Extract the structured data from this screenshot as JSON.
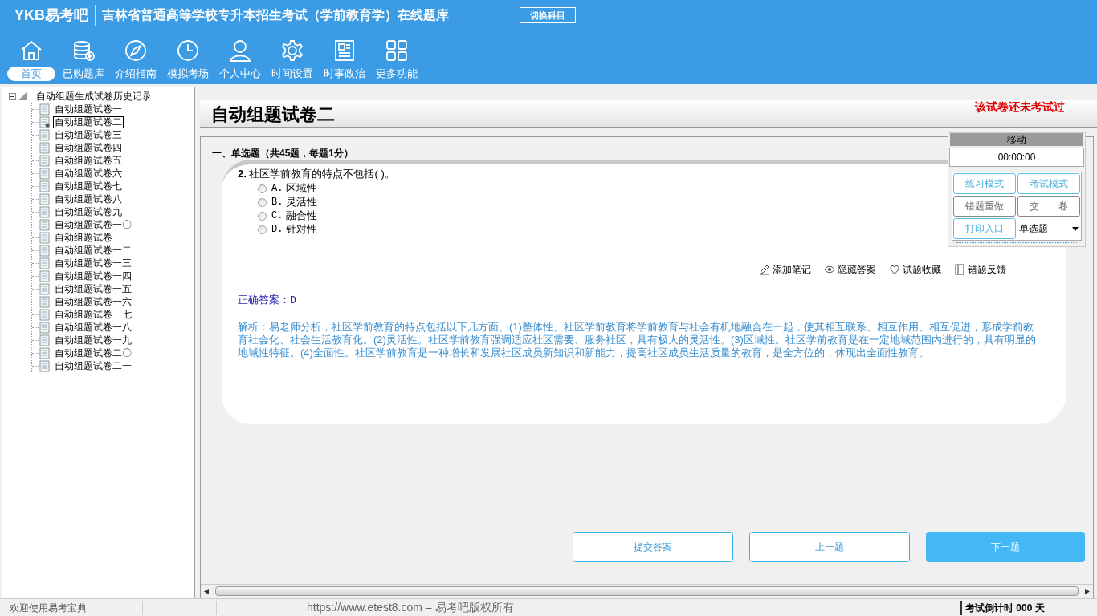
{
  "header": {
    "logo": "YKB易考吧",
    "title": "吉林省普通高等学校专升本招生考试（学前教育学）在线题库",
    "switch_button": "切换科目"
  },
  "nav": [
    {
      "label": "首页",
      "kind": "home",
      "selected": true
    },
    {
      "label": "已购题库",
      "kind": "database",
      "selected": false
    },
    {
      "label": "介绍指南",
      "kind": "compass",
      "selected": false
    },
    {
      "label": "模拟考场",
      "kind": "clock",
      "selected": false
    },
    {
      "label": "个人中心",
      "kind": "user",
      "selected": false
    },
    {
      "label": "时间设置",
      "kind": "gear",
      "selected": false
    },
    {
      "label": "时事政治",
      "kind": "news",
      "selected": false
    },
    {
      "label": "更多功能",
      "kind": "grid",
      "selected": false
    }
  ],
  "tree": {
    "root": "自动组题生成试卷历史记录",
    "expanded": true,
    "children": [
      {
        "label": "自动组题试卷一",
        "selected": false
      },
      {
        "label": "自动组题试卷二",
        "selected": true
      },
      {
        "label": "自动组题试卷三",
        "selected": false
      },
      {
        "label": "自动组题试卷四",
        "selected": false
      },
      {
        "label": "自动组题试卷五",
        "selected": false
      },
      {
        "label": "自动组题试卷六",
        "selected": false
      },
      {
        "label": "自动组题试卷七",
        "selected": false
      },
      {
        "label": "自动组题试卷八",
        "selected": false
      },
      {
        "label": "自动组题试卷九",
        "selected": false
      },
      {
        "label": "自动组题试卷一〇",
        "selected": false
      },
      {
        "label": "自动组题试卷一一",
        "selected": false
      },
      {
        "label": "自动组题试卷一二",
        "selected": false
      },
      {
        "label": "自动组题试卷一三",
        "selected": false
      },
      {
        "label": "自动组题试卷一四",
        "selected": false
      },
      {
        "label": "自动组题试卷一五",
        "selected": false
      },
      {
        "label": "自动组题试卷一六",
        "selected": false
      },
      {
        "label": "自动组题试卷一七",
        "selected": false
      },
      {
        "label": "自动组题试卷一八",
        "selected": false
      },
      {
        "label": "自动组题试卷一九",
        "selected": false
      },
      {
        "label": "自动组题试卷二〇",
        "selected": false
      },
      {
        "label": "自动组题试卷二一",
        "selected": false
      }
    ]
  },
  "paper": {
    "title": "自动组题试卷二",
    "status": "该试卷还未考试过"
  },
  "section": "一、单选题（共45题，每题1分）",
  "question": {
    "number": "2.",
    "text": "社区学前教育的特点不包括( )。",
    "options": [
      {
        "label": "A.",
        "text": "区域性",
        "selected": false
      },
      {
        "label": "B.",
        "text": "灵活性",
        "selected": false
      },
      {
        "label": "C.",
        "text": "融合性",
        "selected": false
      },
      {
        "label": "D.",
        "text": "针对性",
        "selected": false
      }
    ]
  },
  "actions": [
    {
      "label": "添加笔记",
      "kind": "pencil"
    },
    {
      "label": "隐藏答案",
      "kind": "eye"
    },
    {
      "label": "试题收藏",
      "kind": "heart"
    },
    {
      "label": "错题反馈",
      "kind": "book"
    }
  ],
  "answer": "正确答案：D",
  "analysis": "解析：易老师分析，社区学前教育的特点包括以下几方面。(1)整体性。社区学前教育将学前教育与社会有机地融合在一起，使其相互联系、相互作用、相互促进，形成学前教育社会化、社会生活教育化。(2)灵活性。社区学前教育强调适应社区需要、服务社区，具有极大的灵活性。(3)区域性。社区学前教育是在一定地域范围内进行的，具有明显的地域性特征。(4)全面性。社区学前教育是一种增长和发展社区成员新知识和新能力，提高社区成员生活质量的教育，是全方位的，体现出全面性教育。",
  "buttons": [
    {
      "label": "提交答案",
      "kind": "outline"
    },
    {
      "label": "上一题",
      "kind": "outline"
    },
    {
      "label": "下一题",
      "kind": "primary"
    }
  ],
  "panel": {
    "move": "移动",
    "timer": "00:00:00",
    "buttons": [
      {
        "label": "练习模式",
        "kind": "blue"
      },
      {
        "label": "考试模式",
        "kind": "blue"
      },
      {
        "label": "错题重做",
        "kind": "gray"
      },
      {
        "label": "交　　卷",
        "kind": "gray"
      },
      {
        "label": "打印入口",
        "kind": "blue"
      }
    ],
    "dropdown": "单选题"
  },
  "status_bar": {
    "welcome": "欢迎使用易考宝典",
    "copyright": "https://www.etest8.com – 易考吧版权所有",
    "countdown": "考试倒计时 000 天"
  }
}
